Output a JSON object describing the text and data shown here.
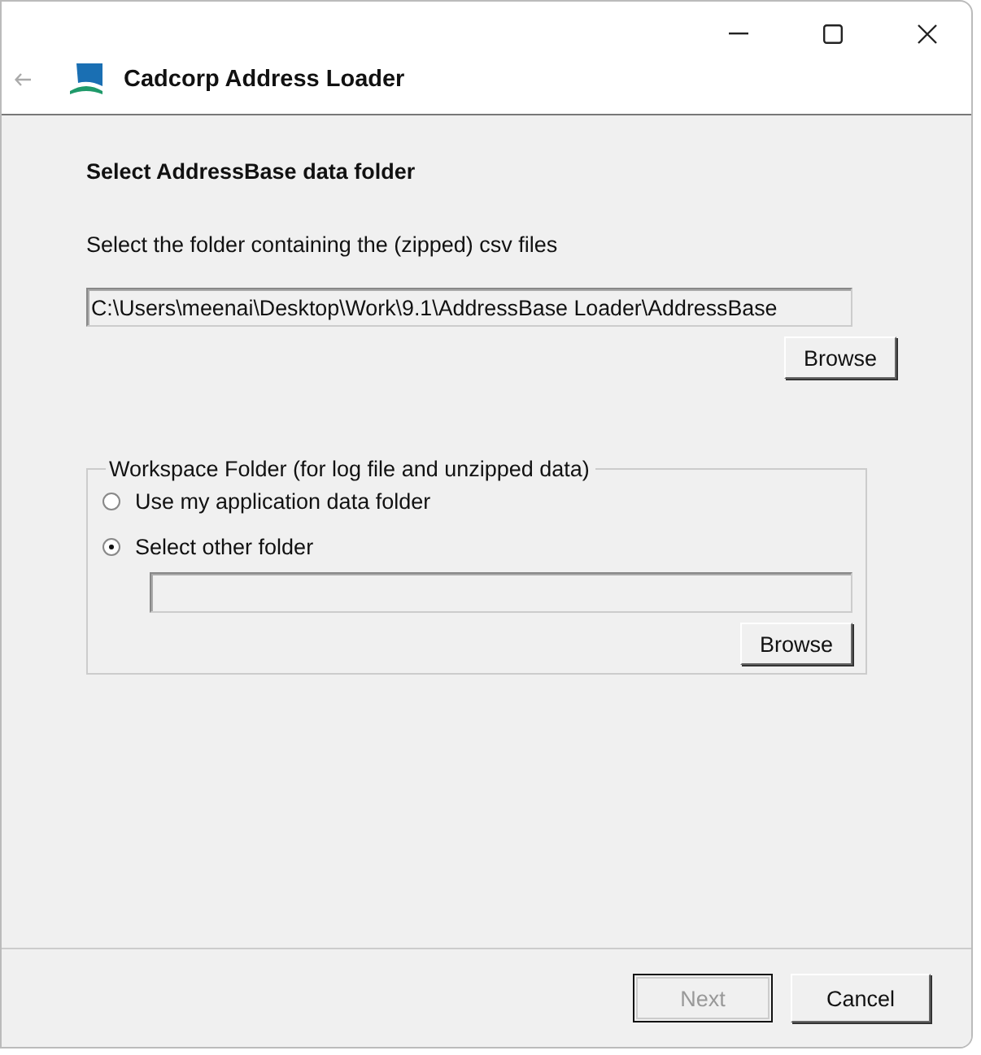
{
  "window": {
    "title": "Cadcorp Address Loader"
  },
  "heading": "Select AddressBase data folder",
  "instruction": "Select the folder containing the (zipped) csv files",
  "source_folder": {
    "value": "C:\\Users\\meenai\\Desktop\\Work\\9.1\\AddressBase Loader\\AddressBase",
    "browse": "Browse"
  },
  "workspace": {
    "title": "Workspace Folder (for log file and unzipped data)",
    "options": [
      {
        "label": "Use my application data folder",
        "selected": false
      },
      {
        "label": "Select other folder",
        "selected": true
      }
    ],
    "browse": "Browse"
  },
  "buttons": [
    {
      "label": "Next",
      "disabled": true
    },
    {
      "label": "Cancel",
      "disabled": false
    }
  ]
}
